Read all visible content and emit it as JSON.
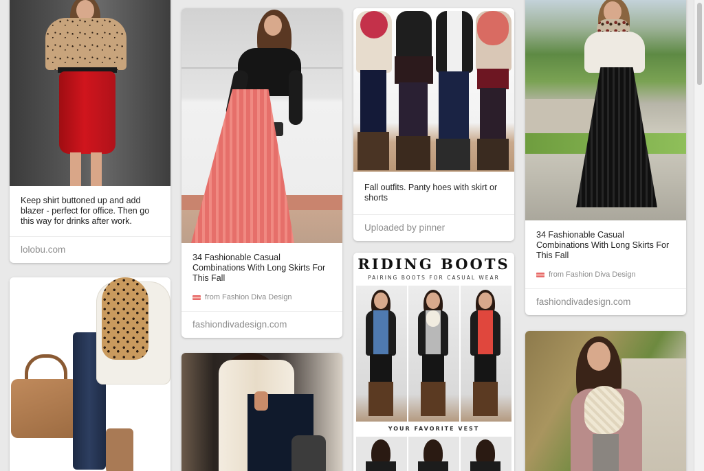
{
  "pins": [
    {
      "description": "Keep shirt buttoned up and add blazer - perfect for office. Then go this way for drinks after work.",
      "domain": "lolobu.com",
      "image_icon": "outfit-photo-leopard-top-red-skirt"
    },
    {
      "description": "",
      "domain": "",
      "image_icon": "outfit-collage-leopard-scarf-boots"
    },
    {
      "description": "34 Fashionable Casual Combinations With Long Skirts For This Fall",
      "source": "from Fashion Diva Design",
      "domain": "fashiondivadesign.com",
      "image_icon": "outfit-photo-pink-maxi-skirt"
    },
    {
      "description": "",
      "domain": "",
      "image_icon": "outfit-photo-cream-scarf"
    },
    {
      "description": "Fall outfits. Panty hoes with skirt or shorts",
      "domain": "Uploaded by pinner",
      "image_icon": "outfit-photo-four-fall-outfits"
    },
    {
      "title": "RIDING BOOTS",
      "subtitle": "PAIRING BOOTS FOR CASUAL WEAR",
      "caption": "YOUR FAVORITE VEST",
      "image_icon": "outfit-collage-riding-boots"
    },
    {
      "description": "34 Fashionable Casual Combinations With Long Skirts For This Fall",
      "source": "from Fashion Diva Design",
      "domain": "fashiondivadesign.com",
      "image_icon": "outfit-photo-black-maxi-skirt"
    },
    {
      "description": "",
      "domain": "",
      "image_icon": "outfit-photo-cream-scarf-cardigan"
    }
  ],
  "colors": {
    "background": "#e9e9e9",
    "card": "#ffffff",
    "domain_text": "#8d8d8d",
    "source_icon": "#e76a6a"
  }
}
